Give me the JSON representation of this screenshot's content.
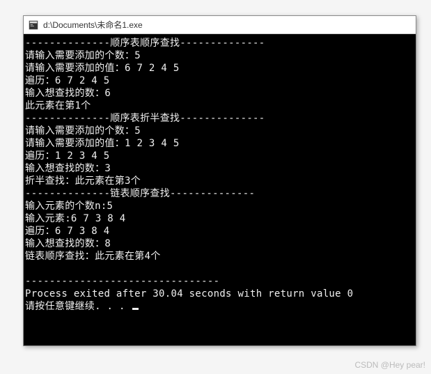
{
  "window": {
    "title": "d:\\Documents\\未命名1.exe"
  },
  "console": {
    "section1_header": "--------------顺序表顺序查找--------------",
    "section1_line1": "请输入需要添加的个数：5",
    "section1_line2": "请输入需要添加的值：6 7 2 4 5",
    "section1_line3": "遍历：6 7 2 4 5",
    "section1_line4": "输入想查找的数：6",
    "section1_line5": "此元素在第1个",
    "section2_header": "--------------顺序表折半查找--------------",
    "section2_line1": "请输入需要添加的个数：5",
    "section2_line2": "请输入需要添加的值：1 2 3 4 5",
    "section2_line3": "遍历：1 2 3 4 5",
    "section2_line4": "输入想查找的数：3",
    "section2_line5": "折半查找：此元素在第3个",
    "section3_header": "--------------链表顺序查找--------------",
    "section3_line1": "输入元素的个数n:5",
    "section3_line2": "输入元素:6 7 3 8 4",
    "section3_line3": "遍历：6 7 3 8 4",
    "section3_line4": "输入想查找的数：8",
    "section3_line5": "链表顺序查找：此元素在第4个",
    "blank": "",
    "divider": "--------------------------------",
    "exit_line": "Process exited after 30.04 seconds with return value 0",
    "continue_line": "请按任意键继续. . . "
  },
  "watermark": "CSDN @Hey pear!"
}
